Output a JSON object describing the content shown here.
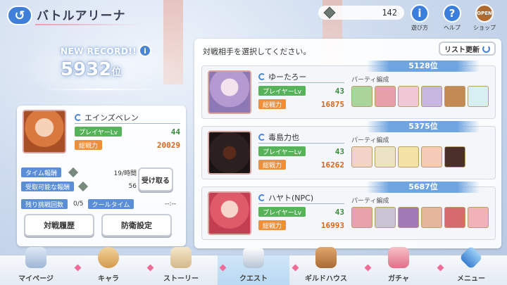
{
  "header": {
    "title": "バトルアリーナ",
    "back_icon": "back-arrow-icon",
    "gem_count": "142",
    "buttons": [
      {
        "label": "遊び方",
        "icon": "help-i-icon",
        "glyph": "i"
      },
      {
        "label": "ヘルプ",
        "icon": "question-icon",
        "glyph": "?"
      },
      {
        "label": "ショップ",
        "icon": "shop-open-icon",
        "glyph": "OPEN"
      }
    ]
  },
  "record": {
    "label": "NEW RECORD!!",
    "info_glyph": "i",
    "rank": "5932",
    "rank_unit": "位"
  },
  "player": {
    "name": "エインズベレン",
    "level_label": "プレイヤーLv",
    "level": "44",
    "power_label": "総戦力",
    "power": "20029",
    "time_reward_label": "タイム報酬",
    "time_reward_value": "19/時間",
    "claimable_label": "受取可能な報酬",
    "claimable_value": "56",
    "claim_button": "受け取る",
    "remaining_label": "残り挑戦回数",
    "remaining_value": "0/5",
    "cooltime_label": "クールタイム",
    "cooltime_value": "--:--",
    "history_button": "対戦履歴",
    "defense_button": "防衛設定"
  },
  "opponents_panel": {
    "title": "対戦相手を選択してください。",
    "refresh_label": "リスト更新",
    "party_label": "パーティ編成",
    "level_label": "プレイヤーLv",
    "power_label": "総戦力",
    "opponents": [
      {
        "rank": "5128位",
        "name": "ゆーたろー",
        "level": "43",
        "power": "16875"
      },
      {
        "rank": "5375位",
        "name": "毒島力也",
        "level": "43",
        "power": "16262"
      },
      {
        "rank": "5687位",
        "name": "ハヤト(NPC)",
        "level": "43",
        "power": "16993"
      }
    ]
  },
  "nav": {
    "items": [
      {
        "label": "マイページ",
        "icon": "castle-icon"
      },
      {
        "label": "キャラ",
        "icon": "character-icon"
      },
      {
        "label": "ストーリー",
        "icon": "scroll-icon"
      },
      {
        "label": "クエスト",
        "icon": "crossed-swords-icon"
      },
      {
        "label": "ギルドハウス",
        "icon": "guild-house-icon"
      },
      {
        "label": "ガチャ",
        "icon": "gacha-icon"
      },
      {
        "label": "メニュー",
        "icon": "crystal-menu-icon"
      }
    ]
  },
  "colors": {
    "accent_blue": "#3f7fd9",
    "level_green": "#56b35a",
    "power_orange": "#ef8f3a"
  }
}
